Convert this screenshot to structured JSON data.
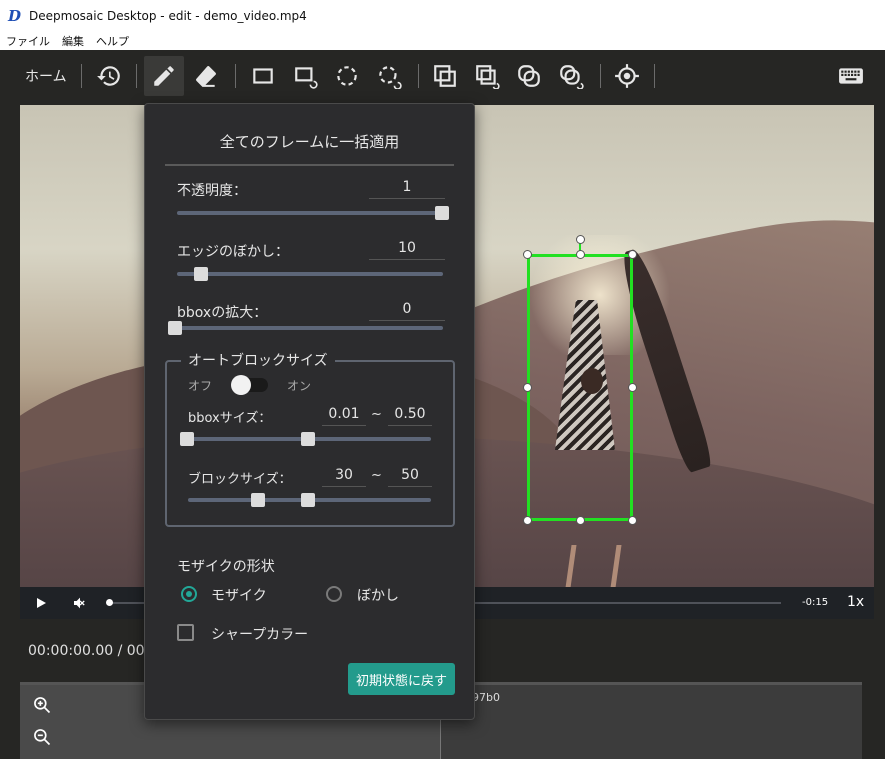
{
  "window": {
    "title": "Deepmosaic Desktop - edit - demo_video.mp4",
    "logo_icon": "app-logo-icon"
  },
  "menu": {
    "items": [
      "ファイル",
      "編集",
      "ヘルプ"
    ]
  },
  "toolbar": {
    "home_label": "ホーム",
    "tools": [
      {
        "name": "history-icon"
      },
      {
        "name": "pencil-icon",
        "active": true
      },
      {
        "name": "eraser-icon"
      },
      {
        "name": "rect-icon"
      },
      {
        "name": "rect-track-icon"
      },
      {
        "name": "ellipse-icon"
      },
      {
        "name": "ellipse-track-icon"
      },
      {
        "name": "copy-rect-icon"
      },
      {
        "name": "copy-rect-track-icon"
      },
      {
        "name": "copy-ellipse-icon"
      },
      {
        "name": "copy-ellipse-track-icon"
      },
      {
        "name": "target-icon"
      },
      {
        "name": "keyboard-icon"
      }
    ]
  },
  "player": {
    "time_remaining": "-0:15",
    "speed": "1x",
    "timecode": "00:00:00.00 / 00:",
    "seek_position": 0.0
  },
  "timeline": {
    "clip_label": "97b0"
  },
  "panel": {
    "title": "全てのフレームに一括適用",
    "opacity": {
      "label": "不透明度：",
      "value": "1",
      "fraction": 1.0
    },
    "blur": {
      "label": "エッジのぼかし：",
      "value": "10",
      "fraction": 0.1
    },
    "bbox_expand": {
      "label": "bboxの拡大：",
      "value": "0",
      "fraction": 0.0
    },
    "auto_block": {
      "legend": "オートブロックサイズ",
      "toggle_off_label": "オフ",
      "toggle_on_label": "オン",
      "toggle_state": "off",
      "bbox_size": {
        "label": "bboxサイズ：",
        "min": "0.01",
        "max": "0.50",
        "tilde": "~"
      },
      "block_size": {
        "label": "ブロックサイズ：",
        "min": "30",
        "max": "50",
        "tilde": "~"
      }
    },
    "shape": {
      "label": "モザイクの形状",
      "options": [
        {
          "label": "モザイク",
          "checked": true
        },
        {
          "label": "ぼかし",
          "checked": false
        }
      ]
    },
    "sharp_color": {
      "label": "シャープカラー",
      "checked": false
    },
    "reset_button": "初期状態に戻す"
  },
  "colors": {
    "accent": "#239b8c",
    "bbox": "#22e022",
    "background": "#262624"
  }
}
